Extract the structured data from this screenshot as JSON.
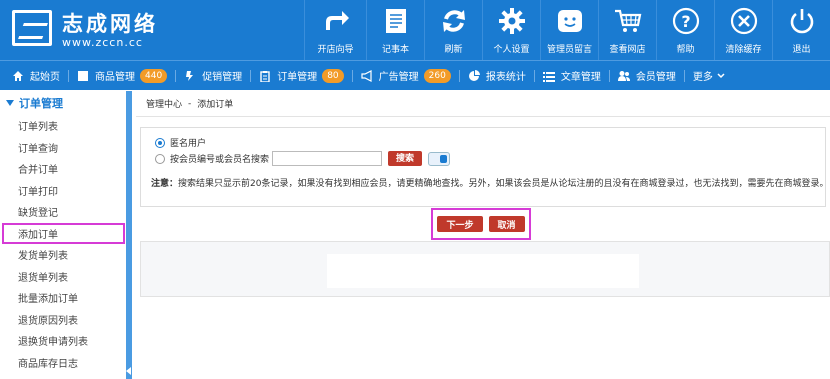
{
  "brand": {
    "title": "志成网络",
    "url": "www.zccn.cc"
  },
  "topnav": [
    {
      "label": "开店向导",
      "icon": "share-arrow-icon"
    },
    {
      "label": "记事本",
      "icon": "notepad-icon"
    },
    {
      "label": "刷新",
      "icon": "refresh-icon"
    },
    {
      "label": "个人设置",
      "icon": "gear-icon"
    },
    {
      "label": "管理员留言",
      "icon": "message-icon"
    },
    {
      "label": "查看网店",
      "icon": "cart-icon"
    },
    {
      "label": "帮助",
      "icon": "help-icon"
    },
    {
      "label": "清除缓存",
      "icon": "clear-icon"
    },
    {
      "label": "退出",
      "icon": "power-icon"
    }
  ],
  "subnav": [
    {
      "label": "起始页",
      "icon": "home-icon",
      "badge": ""
    },
    {
      "label": "商品管理",
      "icon": "box-icon",
      "badge": "440"
    },
    {
      "label": "促销管理",
      "icon": "gift-icon",
      "badge": ""
    },
    {
      "label": "订单管理",
      "icon": "clipboard-icon",
      "badge": "80"
    },
    {
      "label": "广告管理",
      "icon": "megaphone-icon",
      "badge": "260"
    },
    {
      "label": "报表统计",
      "icon": "pie-chart-icon",
      "badge": ""
    },
    {
      "label": "文章管理",
      "icon": "list-icon",
      "badge": ""
    },
    {
      "label": "会员管理",
      "icon": "users-icon",
      "badge": ""
    },
    {
      "label": "更多",
      "icon": "chevron-down-icon",
      "badge": ""
    }
  ],
  "sidebar": {
    "heading": "订单管理",
    "items": [
      "订单列表",
      "订单查询",
      "合并订单",
      "订单打印",
      "缺货登记",
      "添加订单",
      "发货单列表",
      "退货单列表",
      "批量添加订单",
      "退货原因列表",
      "退换货申请列表",
      "商品库存日志"
    ],
    "active_index": 5
  },
  "breadcrumb": {
    "root": "管理中心",
    "sep": "-",
    "current": "添加订单"
  },
  "form": {
    "anonymous_label": "匿名用户",
    "member_search_label": "按会员编号或会员名搜索",
    "search_button": "搜索",
    "note_label": "注意：",
    "note_text": "搜索结果只显示前20条记录，如果没有找到相应会员，请更精确地查找。另外，如果该会员是从论坛注册的且没有在商城登录过，也无法找到，需要先在商城登录。"
  },
  "actions": {
    "next": "下一步",
    "cancel": "取消"
  },
  "colors": {
    "primary": "#1a7bd1",
    "badge": "#f29b28",
    "button": "#c0392b",
    "highlight": "#d63bd6"
  }
}
